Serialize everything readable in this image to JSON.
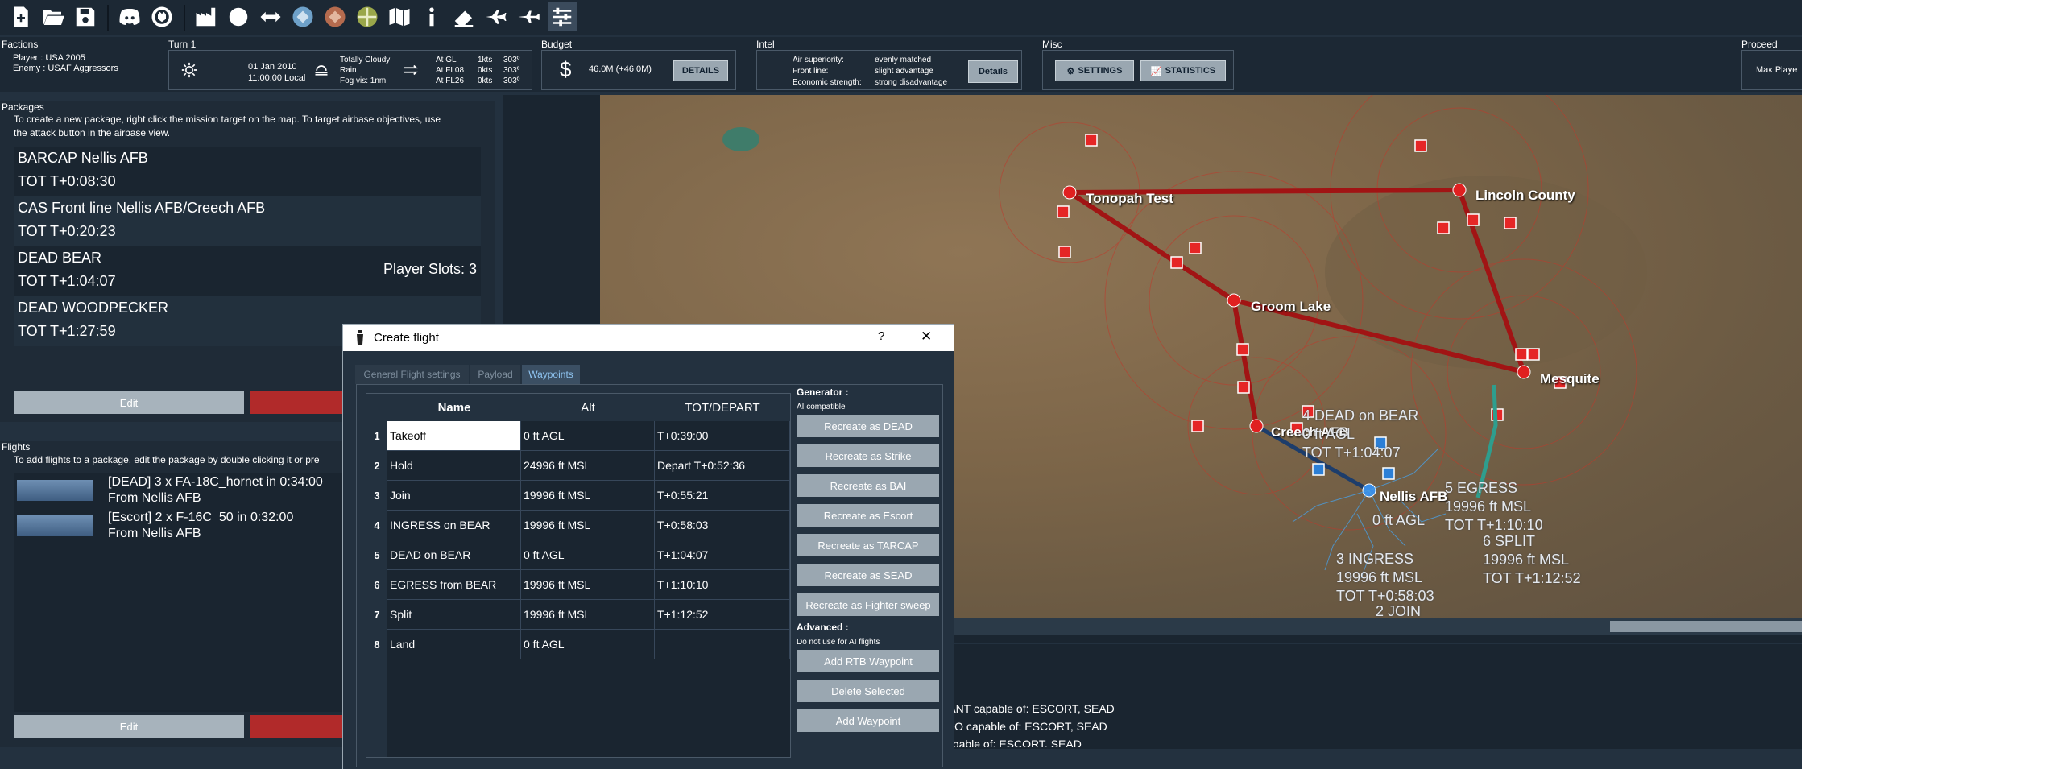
{
  "factions": {
    "title": "Factions",
    "player": "Player : USA 2005",
    "enemy": "Enemy : USAF Aggressors"
  },
  "turn": {
    "title": "Turn 1",
    "date": "01 Jan 2010",
    "time": "11:00:00 Local",
    "weather_line1": "Totally Cloudy",
    "weather_line2": "Rain",
    "weather_line3": "Fog vis: 1nm",
    "wind": [
      {
        "alt": "At GL",
        "speed": "1kts",
        "dir": "303º"
      },
      {
        "alt": "At FL08",
        "speed": "0kts",
        "dir": "303º"
      },
      {
        "alt": "At FL26",
        "speed": "0kts",
        "dir": "303º"
      }
    ]
  },
  "budget": {
    "title": "Budget",
    "amount": "46.0M (+46.0M)",
    "details_label": "DETAILS"
  },
  "intel": {
    "title": "Intel",
    "rows": [
      {
        "label": "Air superiority:",
        "value": "evenly matched"
      },
      {
        "label": "Front line:",
        "value": "slight advantage"
      },
      {
        "label": "Economic strength:",
        "value": "strong disadvantage"
      }
    ],
    "details_label": "Details"
  },
  "misc": {
    "title": "Misc",
    "settings_label": "SETTINGS",
    "statistics_label": "STATISTICS"
  },
  "proceed": {
    "title": "Proceed",
    "button_label": "Max Playe"
  },
  "packages": {
    "title": "Packages",
    "description_line1": "To create a new package, right click the mission target on the map. To target airbase objectives, use",
    "description_line2": "the attack button in the airbase view.",
    "items": [
      {
        "name": "BARCAP Nellis AFB",
        "tot": "TOT T+0:08:30",
        "slots": ""
      },
      {
        "name": "CAS Front line Nellis AFB/Creech AFB",
        "tot": "TOT T+0:20:23",
        "slots": ""
      },
      {
        "name": "DEAD BEAR",
        "tot": "TOT T+1:04:07",
        "slots": "Player Slots: 3"
      },
      {
        "name": "DEAD WOODPECKER",
        "tot": "TOT T+1:27:59",
        "slots": ""
      }
    ],
    "edit_label": "Edit"
  },
  "flights": {
    "title": "Flights",
    "description": "To add flights to a package, edit the package by double clicking it or pre",
    "items": [
      {
        "line1": "[DEAD] 3 x FA-18C_hornet in 0:34:00",
        "line2": "From Nellis AFB"
      },
      {
        "line1": "[Escort] 2 x F-16C_50 in 0:32:00",
        "line2": "From Nellis AFB"
      }
    ],
    "edit_label": "Edit"
  },
  "map": {
    "bases": [
      "Tonopah Test",
      "Lincoln County",
      "Groom Lake",
      "Mesquite",
      "Creech AFB",
      "Nellis AFB"
    ],
    "waypoint_labels": [
      "4 DEAD on BEAR\n0 ft AGL\nTOT T+1:04:07",
      "0 ft AGL",
      "5 EGRESS\n19996 ft MSL\nTOT T+1:10:10",
      "6 SPLIT\n19996 ft MSL\nTOT T+1:12:52",
      "3 INGRESS\n19996 ft MSL\nTOT T+0:58:03",
      "2 JOIN"
    ]
  },
  "info_lines": [
    "SANT capable of: ESCORT, SEAD",
    "ALO capable of: ESCORT, SEAD",
    "capable of: ESCORT, SEAD"
  ],
  "dialog": {
    "title": "Create flight",
    "help": "?",
    "close": "✕",
    "tabs": [
      "General Flight settings",
      "Payload",
      "Waypoints"
    ],
    "active_tab": "Waypoints",
    "columns": [
      "Name",
      "Alt",
      "TOT/DEPART"
    ],
    "waypoints": [
      {
        "num": "1",
        "name": "Takeoff",
        "alt": "0 ft AGL",
        "tot": "T+0:39:00"
      },
      {
        "num": "2",
        "name": "Hold",
        "alt": "24996 ft MSL",
        "tot": "Depart T+0:52:36"
      },
      {
        "num": "3",
        "name": "Join",
        "alt": "19996 ft MSL",
        "tot": "T+0:55:21"
      },
      {
        "num": "4",
        "name": "INGRESS on BEAR",
        "alt": "19996 ft MSL",
        "tot": "T+0:58:03"
      },
      {
        "num": "5",
        "name": "DEAD on BEAR",
        "alt": "0 ft AGL",
        "tot": "T+1:04:07"
      },
      {
        "num": "6",
        "name": "EGRESS from BEAR",
        "alt": "19996 ft MSL",
        "tot": "T+1:10:10"
      },
      {
        "num": "7",
        "name": "Split",
        "alt": "19996 ft MSL",
        "tot": "T+1:12:52"
      },
      {
        "num": "8",
        "name": "Land",
        "alt": "0 ft AGL",
        "tot": ""
      }
    ],
    "generator_title": "Generator :",
    "generator_sub": "AI compatible",
    "generator_buttons": [
      "Recreate as DEAD",
      "Recreate as Strike",
      "Recreate as BAI",
      "Recreate as Escort",
      "Recreate as TARCAP",
      "Recreate as SEAD",
      "Recreate as Fighter sweep"
    ],
    "advanced_title": "Advanced :",
    "advanced_sub": "Do not use for AI flights",
    "advanced_buttons": [
      "Add RTB Waypoint",
      "Delete Selected",
      "Add Waypoint"
    ]
  },
  "colors": {
    "background": "#23313f",
    "panel": "#1f2b37",
    "accent_blue": "#8ec3ef",
    "enemy_red": "#b01818",
    "button_grey": "#9aa7b1"
  }
}
